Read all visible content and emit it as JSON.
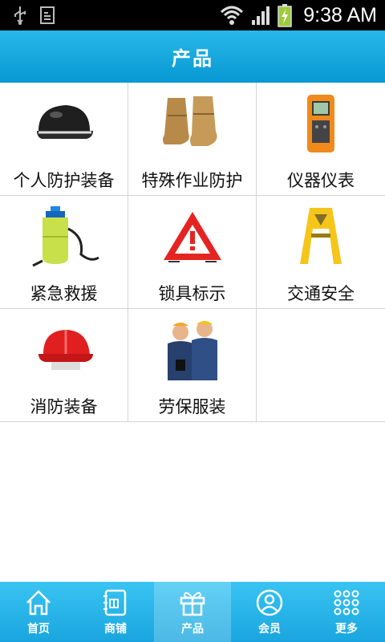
{
  "status_bar": {
    "time": "9:38 AM"
  },
  "header": {
    "title": "产品"
  },
  "products": [
    {
      "label": "个人防护装备",
      "icon": "helmet-icon"
    },
    {
      "label": "特殊作业防护",
      "icon": "boots-icon"
    },
    {
      "label": "仪器仪表",
      "icon": "detector-icon"
    },
    {
      "label": "紧急救援",
      "icon": "sprayer-icon"
    },
    {
      "label": "锁具标示",
      "icon": "warning-triangle-icon"
    },
    {
      "label": "交通安全",
      "icon": "caution-sign-icon"
    },
    {
      "label": "消防装备",
      "icon": "fire-helmet-icon"
    },
    {
      "label": "劳保服装",
      "icon": "workwear-icon"
    }
  ],
  "tabs": [
    {
      "label": "首页",
      "icon": "home-icon",
      "active": false
    },
    {
      "label": "商铺",
      "icon": "shop-icon",
      "active": false
    },
    {
      "label": "产品",
      "icon": "gift-icon",
      "active": true
    },
    {
      "label": "会员",
      "icon": "member-icon",
      "active": false
    },
    {
      "label": "更多",
      "icon": "more-grid-icon",
      "active": false
    }
  ],
  "colors": {
    "header": "#0ea3dc",
    "tabbar": "#22acdf",
    "status_bar": "#000000"
  }
}
